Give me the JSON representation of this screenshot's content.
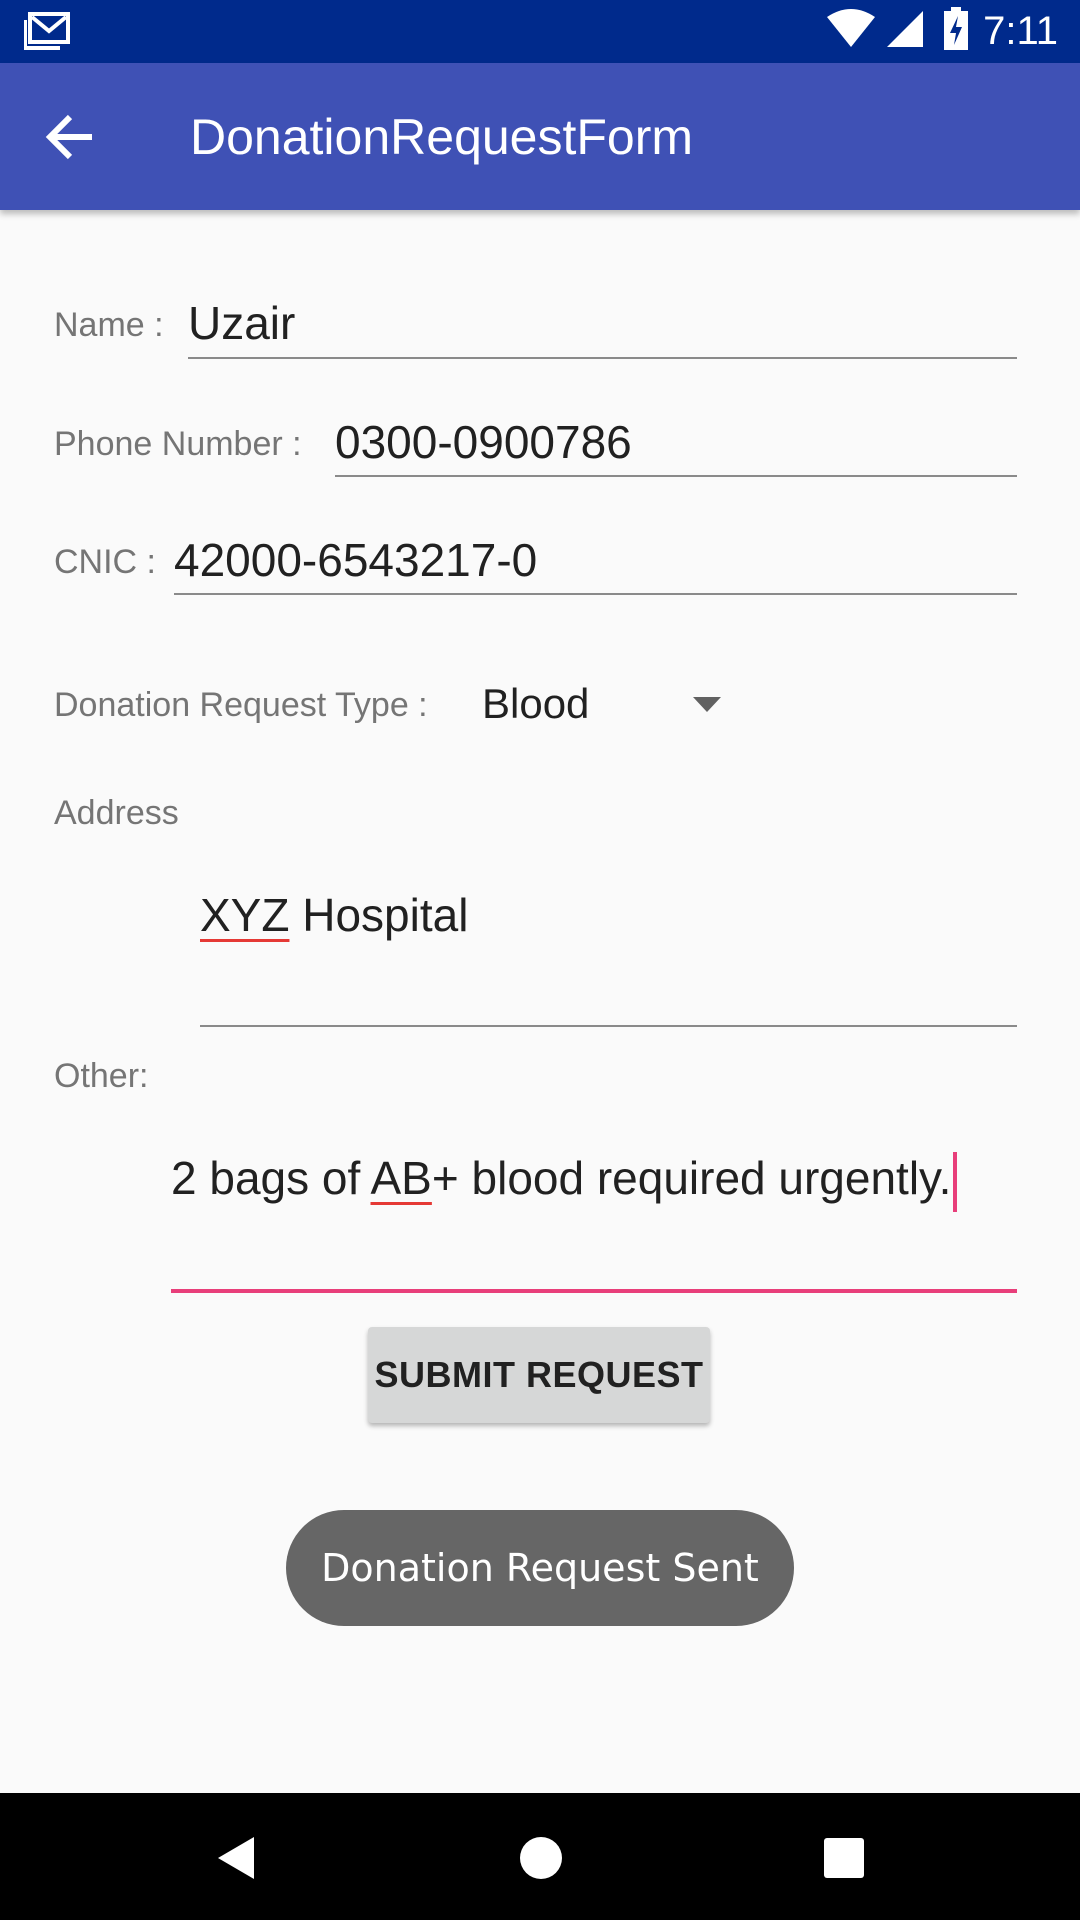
{
  "status_bar": {
    "time": "7:11",
    "icons": [
      "gmail-icon",
      "wifi-icon",
      "signal-icon",
      "battery-charging-icon"
    ]
  },
  "app_bar": {
    "title": "DonationRequestForm",
    "back_icon": "arrow-back-icon"
  },
  "form": {
    "name": {
      "label": "Name :",
      "value": "Uzair"
    },
    "phone": {
      "label": "Phone Number :",
      "value": "0300-0900786"
    },
    "cnic": {
      "label": "CNIC :",
      "value": "42000-6543217-0"
    },
    "donation_type": {
      "label": "Donation Request Type :",
      "selected": "Blood"
    },
    "address": {
      "label": "Address",
      "value_underlined": "XYZ",
      "value_rest": " Hospital"
    },
    "other": {
      "label": "Other:",
      "value_part1": "2 bags of ",
      "value_underlined": "AB",
      "value_part2": "+ blood required urgently."
    },
    "submit_label": "SUBMIT REQUEST"
  },
  "toast": {
    "message": "Donation Request Sent"
  },
  "nav_bar": {
    "icons": [
      "back-triangle-icon",
      "home-circle-icon",
      "recents-square-icon"
    ]
  }
}
